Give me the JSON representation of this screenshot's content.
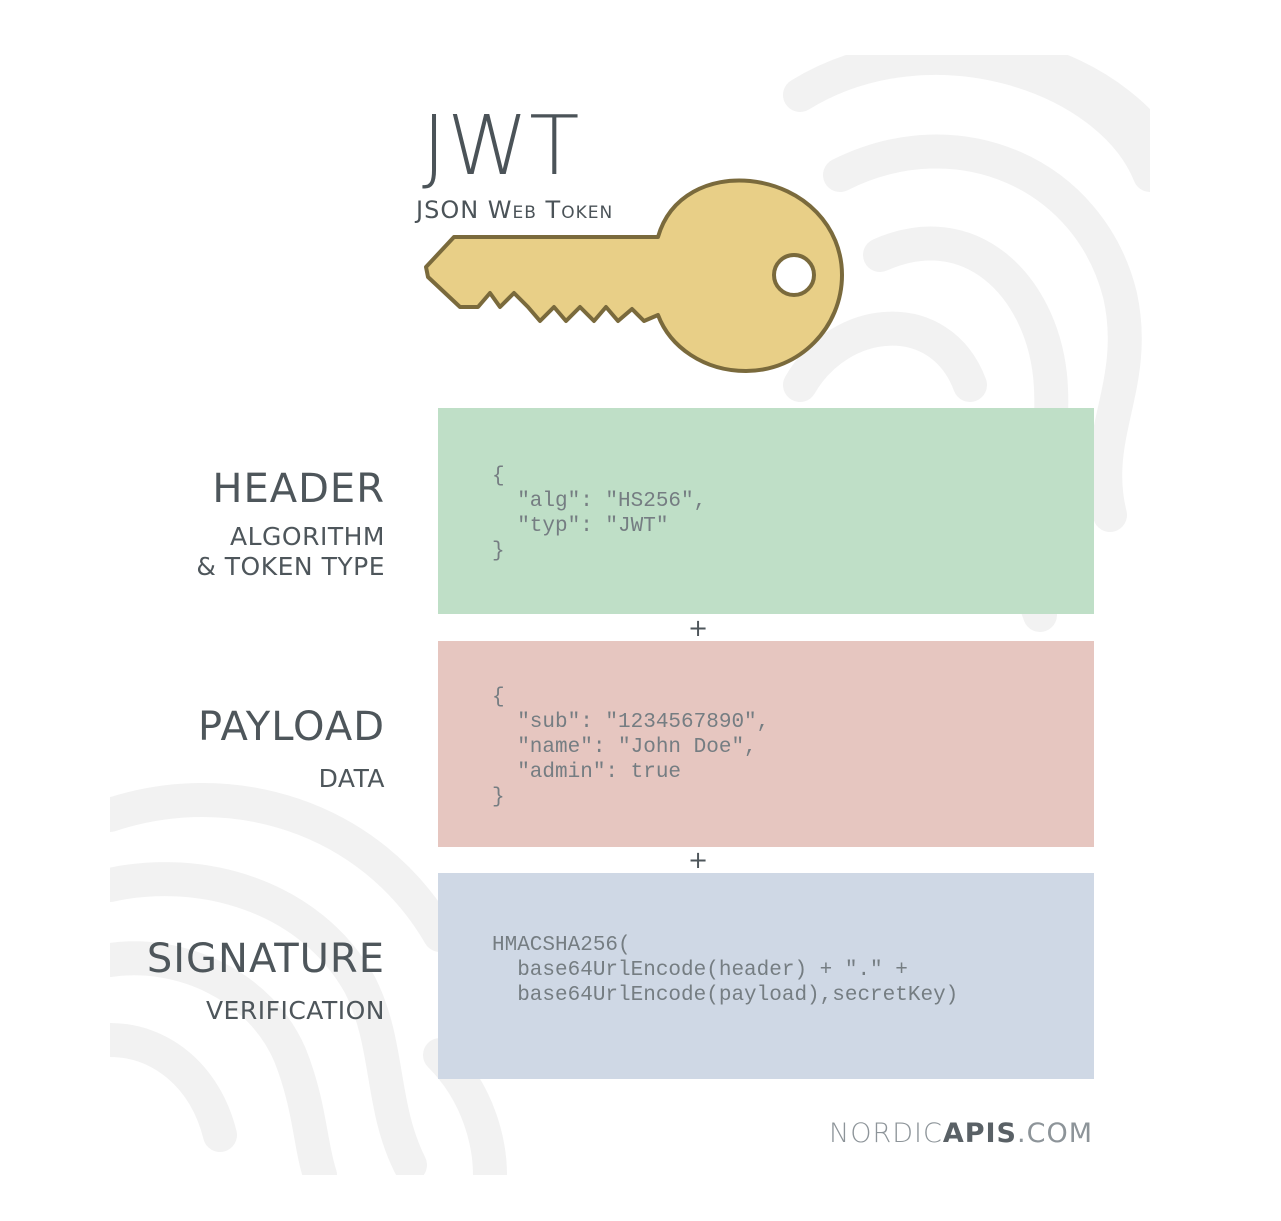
{
  "logo": {
    "title": "JWT",
    "subtitle": "JSON Web Token",
    "key_color": "#e8cf87",
    "key_outline": "#7a6a3c"
  },
  "sections": [
    {
      "title": "HEADER",
      "subtitle": "ALGORITHM\n& TOKEN TYPE",
      "code": "{\n  \"alg\": \"HS256\",\n  \"typ\": \"JWT\"\n}",
      "color": "#bfdfc7"
    },
    {
      "title": "PAYLOAD",
      "subtitle": "DATA",
      "code": "{\n  \"sub\": \"1234567890\",\n  \"name\": \"John Doe\",\n  \"admin\": true\n}",
      "color": "#e6c6c0"
    },
    {
      "title": "SIGNATURE",
      "subtitle": "VERIFICATION",
      "code": "HMACSHA256(\n  base64UrlEncode(header) + \".\" +\n  base64UrlEncode(payload),secretKey)",
      "color": "#cfd8e5"
    }
  ],
  "operators": [
    "+",
    "+"
  ],
  "footer": {
    "prefix": "NORDIC",
    "brand": "APIS",
    "suffix": ".COM"
  }
}
